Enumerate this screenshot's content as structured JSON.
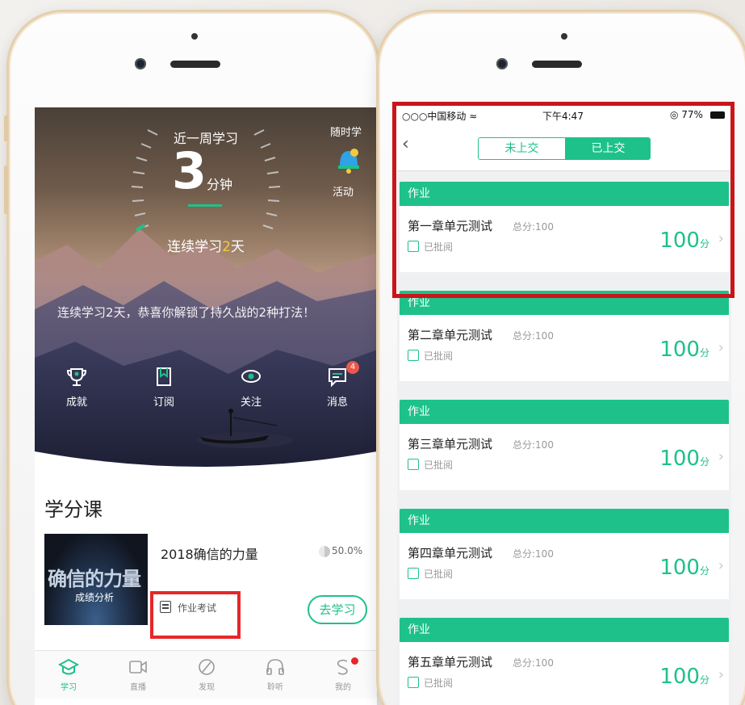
{
  "colors": {
    "accent": "#1ec18a",
    "highlight_frame": "#c8161b",
    "badge": "#e9584a",
    "streak_highlight": "#f3c940"
  },
  "left_screen": {
    "hero": {
      "week_label": "近一周学习",
      "minutes": "3",
      "minutes_unit": "分钟",
      "streak_prefix": "连续学习",
      "streak_days": "2",
      "streak_suffix": "天",
      "anytime_label": "随时学",
      "activity_label": "活动",
      "unlock_text": "连续学习2天，恭喜你解锁了持久战的2种打法！"
    },
    "quick_actions": [
      {
        "label": "成就",
        "icon": "trophy-icon"
      },
      {
        "label": "订阅",
        "icon": "bookmark-icon"
      },
      {
        "label": "关注",
        "icon": "eye-icon"
      },
      {
        "label": "消息",
        "icon": "message-icon",
        "badge": "4"
      }
    ],
    "section_title": "学分课",
    "course": {
      "thumb_title": "确信的力量",
      "thumb_subtitle": "成绩分析",
      "name": "2018确信的力量",
      "progress_text": "50.0%",
      "progress": 0.5,
      "homework_tag": "作业考试",
      "study_button": "去学习"
    },
    "tabbar": [
      {
        "label": "学习",
        "icon": "graduation-cap-icon",
        "active": true
      },
      {
        "label": "直播",
        "icon": "video-camera-icon",
        "active": false
      },
      {
        "label": "发现",
        "icon": "compass-icon",
        "active": false
      },
      {
        "label": "聆听",
        "icon": "headphones-icon",
        "active": false
      },
      {
        "label": "我的",
        "icon": "user-icon",
        "active": false
      }
    ]
  },
  "right_screen": {
    "status_bar": {
      "carrier": "○○○中国移动 ≈",
      "time": "下午4:47",
      "battery": "◎ 77%"
    },
    "back_icon": "‹",
    "segments": [
      "未上交",
      "已上交"
    ],
    "active_segment": "已上交",
    "homework_header": "作业",
    "items": [
      {
        "title": "第一章单元测试",
        "total": "总分:100",
        "status": "已批阅",
        "score": "100",
        "score_unit": "分"
      },
      {
        "title": "第二章单元测试",
        "total": "总分:100",
        "status": "已批阅",
        "score": "100",
        "score_unit": "分"
      },
      {
        "title": "第三章单元测试",
        "total": "总分:100",
        "status": "已批阅",
        "score": "100",
        "score_unit": "分"
      },
      {
        "title": "第四章单元测试",
        "total": "总分:100",
        "status": "已批阅",
        "score": "100",
        "score_unit": "分"
      },
      {
        "title": "第五章单元测试",
        "total": "总分:100",
        "status": "已批阅",
        "score": "100",
        "score_unit": "分"
      }
    ],
    "chevron": "›"
  }
}
